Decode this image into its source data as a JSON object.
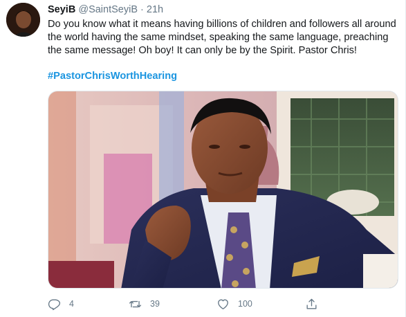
{
  "tweet": {
    "display_name": "SeyiB",
    "handle": "@SaintSeyiB",
    "separator": "·",
    "time": "21h",
    "text": "Do you know what it means having billions of children and followers all around the world having the same mindset, speaking the same language, preaching the same message! Oh boy! It can only be by the Spirit. Pastor Chris!",
    "hashtag": "#PastorChrisWorthHearing"
  },
  "actions": {
    "reply": {
      "icon": "reply-icon",
      "count": "4"
    },
    "retweet": {
      "icon": "retweet-icon",
      "count": "39"
    },
    "like": {
      "icon": "heart-icon",
      "count": "100"
    },
    "share": {
      "icon": "share-icon",
      "count": ""
    }
  },
  "colors": {
    "link": "#1b95e0",
    "muted": "#657786",
    "text": "#14171a"
  }
}
